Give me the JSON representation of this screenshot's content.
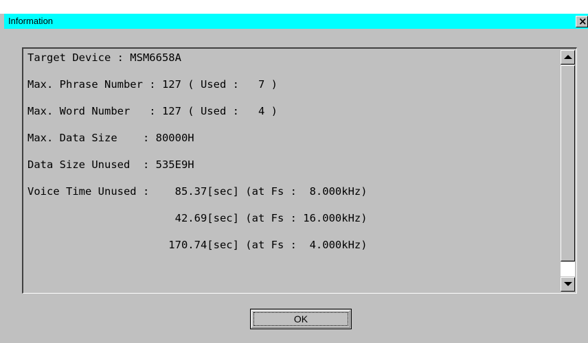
{
  "window": {
    "title": "Information",
    "close_glyph": "×"
  },
  "info_text": {
    "lines": [
      "Target Device : MSM6658A",
      "Max. Phrase Number : 127 ( Used :   7 )",
      "Max. Word Number   : 127 ( Used :   4 )",
      "Max. Data Size    : 80000H",
      "Data Size Unused  : 535E9H",
      "Voice Time Unused :    85.37[sec] (at Fs :  8.000kHz)",
      "                       42.69[sec] (at Fs : 16.000kHz)",
      "                      170.74[sec] (at Fs :  4.000kHz)"
    ]
  },
  "buttons": {
    "ok_label": "OK"
  },
  "icons": {
    "close": "close-icon",
    "scroll_up": "arrow-up-icon",
    "scroll_down": "arrow-down-icon"
  },
  "colors": {
    "titlebar": "#00ffff",
    "face": "#c0c0c0"
  }
}
